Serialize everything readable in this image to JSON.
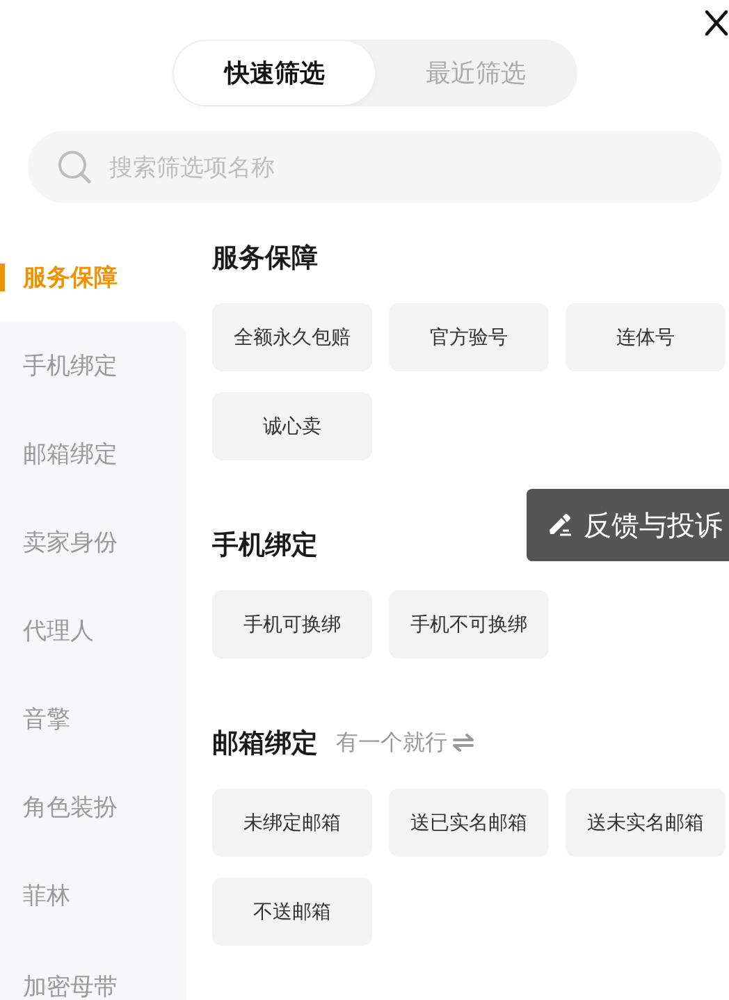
{
  "tabs": [
    {
      "label": "快速筛选",
      "selected": true
    },
    {
      "label": "最近筛选",
      "selected": false
    }
  ],
  "search": {
    "placeholder": "搜索筛选项名称"
  },
  "sidebar": {
    "items": [
      {
        "label": "服务保障",
        "selected": true
      },
      {
        "label": "手机绑定",
        "selected": false
      },
      {
        "label": "邮箱绑定",
        "selected": false
      },
      {
        "label": "卖家身份",
        "selected": false
      },
      {
        "label": "代理人",
        "selected": false
      },
      {
        "label": "音擎",
        "selected": false
      },
      {
        "label": "角色装扮",
        "selected": false
      },
      {
        "label": "菲林",
        "selected": false
      },
      {
        "label": "加密母带",
        "selected": false
      }
    ]
  },
  "sections": [
    {
      "title": "服务保障",
      "options": [
        "全额永久包赔",
        "官方验号",
        "连体号",
        "诚心卖"
      ]
    },
    {
      "title": "手机绑定",
      "options": [
        "手机可换绑",
        "手机不可换绑"
      ]
    },
    {
      "title": "邮箱绑定",
      "hint": "有一个就行",
      "options": [
        "未绑定邮箱",
        "送已实名邮箱",
        "送未实名邮箱",
        "不送邮箱"
      ]
    }
  ],
  "feedback_button": {
    "label": "反馈与投诉"
  }
}
